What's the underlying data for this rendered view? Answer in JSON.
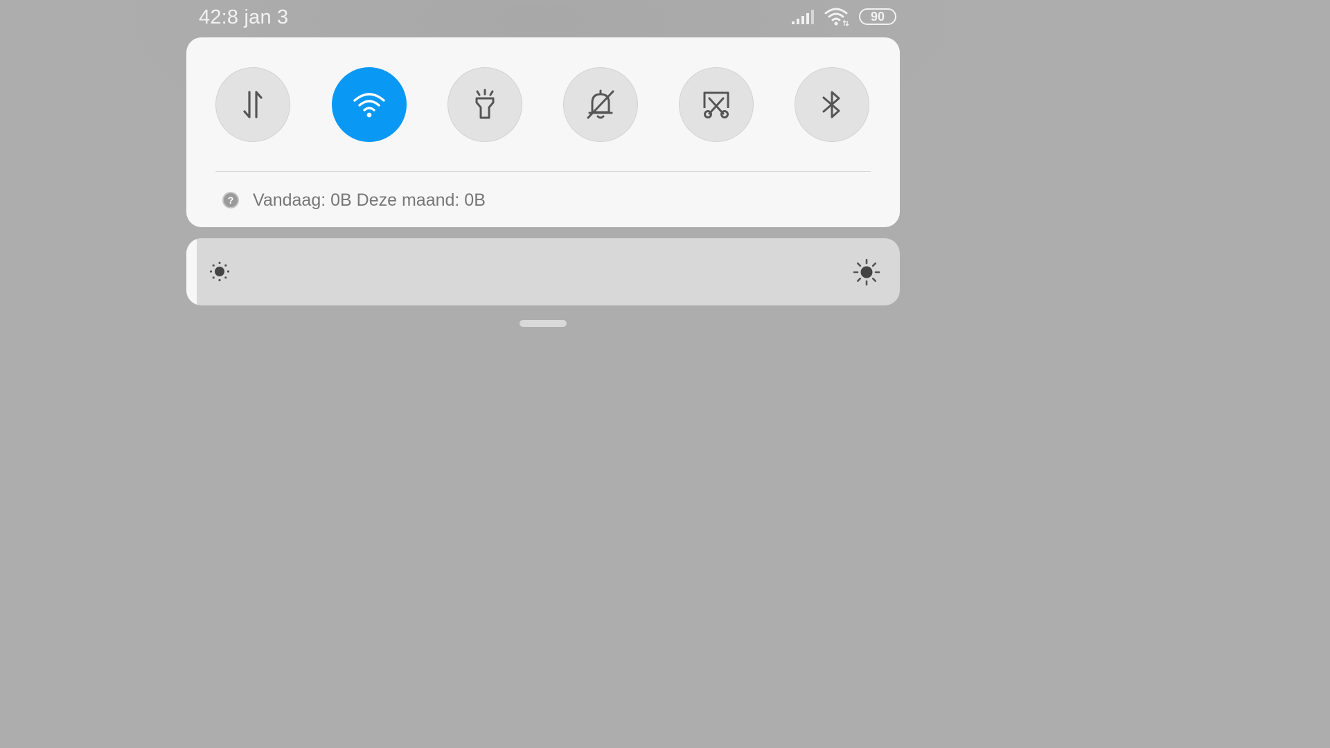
{
  "status_bar": {
    "time": "42:8 jan 3",
    "battery": "90",
    "icons": [
      "signal-icon",
      "wifi-icon",
      "battery-icon"
    ]
  },
  "quick_toggles": [
    {
      "name": "mobile-data",
      "icon": "arrows-up-down-icon",
      "active": false
    },
    {
      "name": "wifi",
      "icon": "wifi-icon",
      "active": true
    },
    {
      "name": "flashlight",
      "icon": "flashlight-icon",
      "active": false
    },
    {
      "name": "silent",
      "icon": "bell-off-icon",
      "active": false
    },
    {
      "name": "screenshot",
      "icon": "scissors-icon",
      "active": false
    },
    {
      "name": "bluetooth",
      "icon": "bluetooth-icon",
      "active": false
    }
  ],
  "data_usage": {
    "text": "Vandaag: 0B Deze maand: 0B",
    "help_icon": "?"
  },
  "brightness": {
    "level": 0.015,
    "low_icon": "sun-small-icon",
    "high_icon": "sun-large-icon"
  },
  "colors": {
    "accent": "#0a98f5",
    "panel": "#f7f7f7",
    "background": "#adadad"
  }
}
